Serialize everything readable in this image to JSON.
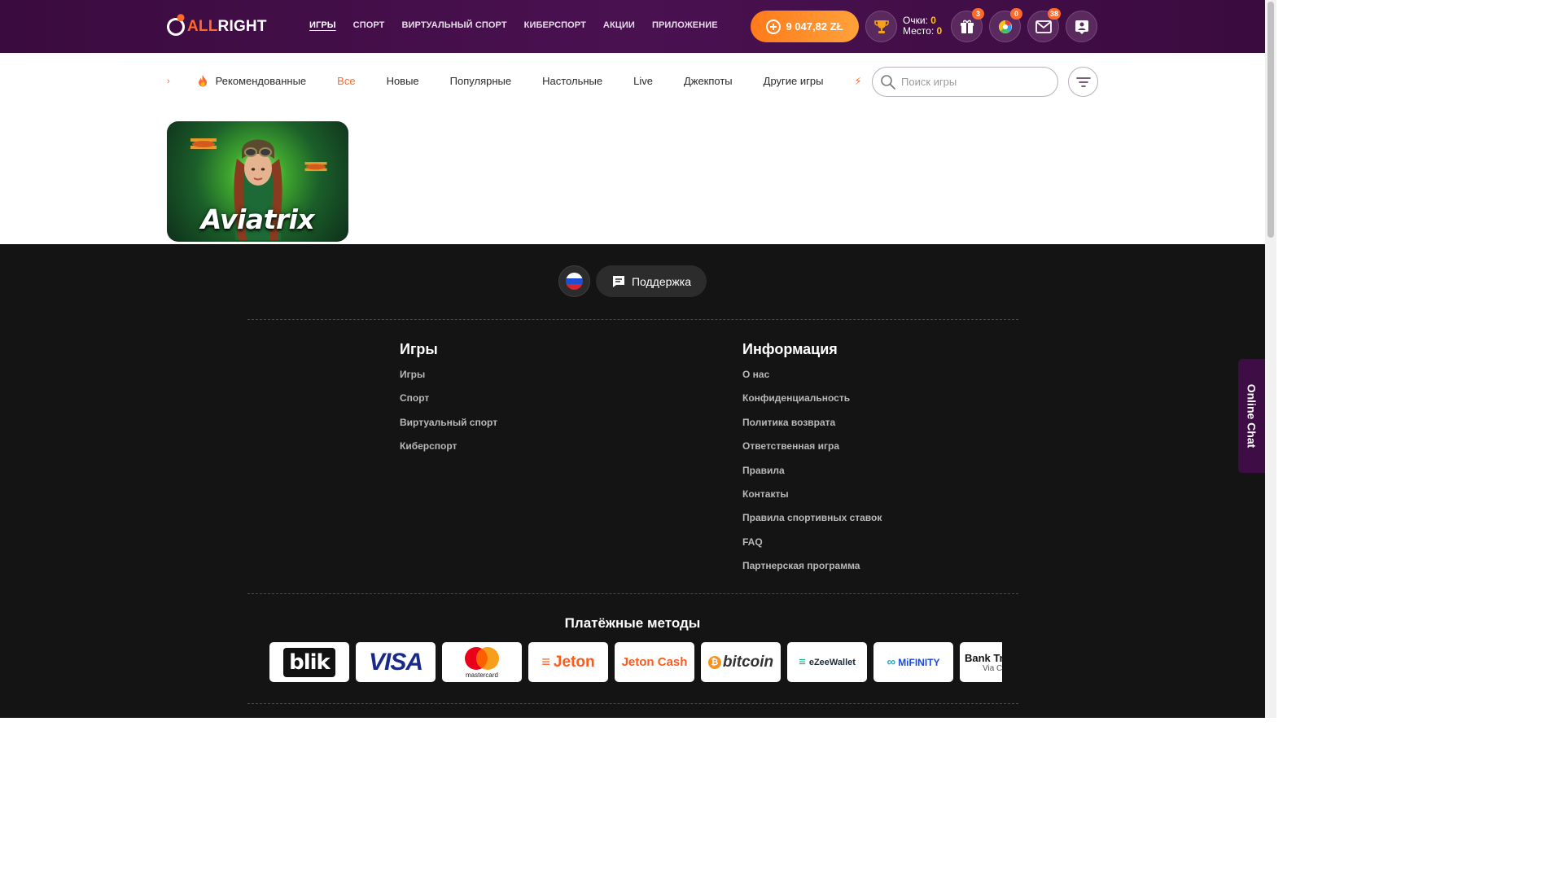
{
  "header": {
    "logo": {
      "part1": "ALL",
      "part2": "RIGHT"
    },
    "nav": [
      "ИГРЫ",
      "СПОРТ",
      "ВИРТУАЛЬНЫЙ СПОРТ",
      "КИБЕРСПОРТ",
      "АКЦИИ",
      "ПРИЛОЖЕНИЕ"
    ],
    "balance": "9 047,82 ZŁ",
    "points_label": "Очки:",
    "points_value": "0",
    "place_label": "Место:",
    "place_value": "0",
    "badges": {
      "gifts": "3",
      "wheel": "0",
      "messages": "38"
    },
    "icons": [
      "trophy-icon",
      "gift-icon",
      "wheel-icon",
      "mail-icon",
      "profile-icon"
    ]
  },
  "categories": {
    "items": [
      "Рекомендованные",
      "Все",
      "Новые",
      "Популярные",
      "Настольные",
      "Live",
      "Джекпоты",
      "Другие игры"
    ],
    "active": "Все",
    "search_placeholder": "Поиск игры"
  },
  "games": [
    {
      "title": "Aviatrix"
    }
  ],
  "footer": {
    "support_label": "Поддержка",
    "games_col": {
      "title": "Игры",
      "links": [
        "Игры",
        "Спорт",
        "Виртуальный спорт",
        "Киберспорт"
      ]
    },
    "info_col": {
      "title": "Информация",
      "links": [
        "О нас",
        "Конфиденциальность",
        "Политика возврата",
        "Ответственная игра",
        "Правила",
        "Контакты",
        "Правила спортивных ставок",
        "FAQ",
        "Партнерская программа"
      ]
    },
    "payments_title": "Платёжные методы",
    "payments": [
      "blik",
      "VISA",
      "mastercard",
      "Jeton",
      "Jeton Cash",
      "bitcoin",
      "eZeeWallet",
      "MiFINITY",
      "Bank Tr",
      "Via C"
    ]
  },
  "online_chat": "Online Chat",
  "colors": {
    "header_bg": "#3a0b3f",
    "accent": "#ff6a2a",
    "footer_bg": "#141414",
    "points_value": "#ffc21a"
  }
}
